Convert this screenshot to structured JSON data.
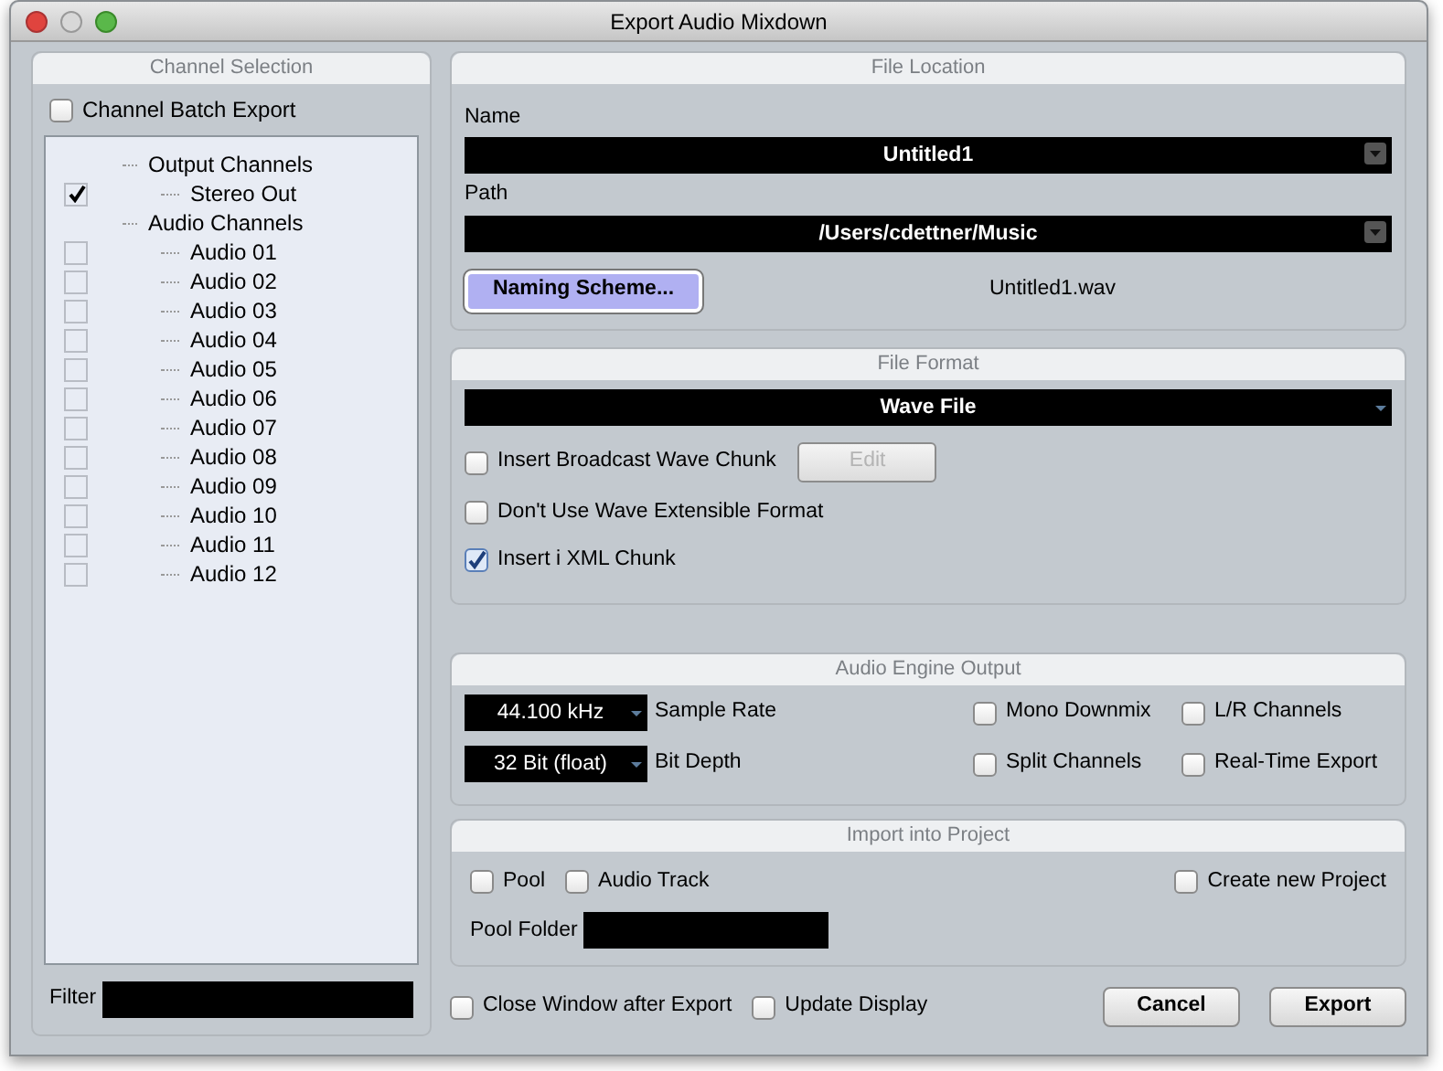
{
  "window": {
    "title": "Export Audio Mixdown"
  },
  "channel_selection": {
    "title": "Channel Selection",
    "batch_export": {
      "label": "Channel Batch Export",
      "checked": false
    },
    "tree": [
      {
        "label": "Output Channels",
        "children": [
          {
            "label": "Stereo Out",
            "checked": true
          }
        ]
      },
      {
        "label": "Audio Channels",
        "children": [
          {
            "label": "Audio 01",
            "checked": false
          },
          {
            "label": "Audio 02",
            "checked": false
          },
          {
            "label": "Audio 03",
            "checked": false
          },
          {
            "label": "Audio 04",
            "checked": false
          },
          {
            "label": "Audio 05",
            "checked": false
          },
          {
            "label": "Audio 06",
            "checked": false
          },
          {
            "label": "Audio 07",
            "checked": false
          },
          {
            "label": "Audio 08",
            "checked": false
          },
          {
            "label": "Audio 09",
            "checked": false
          },
          {
            "label": "Audio 10",
            "checked": false
          },
          {
            "label": "Audio 11",
            "checked": false
          },
          {
            "label": "Audio 12",
            "checked": false
          }
        ]
      }
    ],
    "filter": {
      "label": "Filter"
    }
  },
  "file_location": {
    "title": "File Location",
    "name_label": "Name",
    "name_value": "Untitled1",
    "path_label": "Path",
    "path_value": "/Users/cdettner/Music",
    "naming_button": "Naming Scheme...",
    "file_name": "Untitled1.wav"
  },
  "file_format": {
    "title": "File Format",
    "format": "Wave File",
    "options": [
      {
        "label": "Insert Broadcast Wave Chunk",
        "checked": false,
        "button": {
          "label": "Edit",
          "disabled": true
        }
      },
      {
        "label": "Don't Use Wave Extensible Format",
        "checked": false
      },
      {
        "label": "Insert i XML Chunk",
        "checked": true
      }
    ]
  },
  "audio_engine": {
    "title": "Audio Engine Output",
    "selects": [
      {
        "value": "44.100 kHz",
        "label": "Sample Rate"
      },
      {
        "value": "32 Bit (float)",
        "label": "Bit Depth"
      }
    ],
    "options": [
      {
        "label": "Mono Downmix",
        "checked": false
      },
      {
        "label": "L/R Channels",
        "checked": false
      },
      {
        "label": "Split Channels",
        "checked": false
      },
      {
        "label": "Real-Time Export",
        "checked": false
      }
    ]
  },
  "import_project": {
    "title": "Import into Project",
    "options": [
      {
        "label": "Pool",
        "checked": false
      },
      {
        "label": "Audio Track",
        "checked": false
      },
      {
        "label": "Create new Project",
        "checked": false
      }
    ],
    "pool_folder_label": "Pool Folder"
  },
  "footer": {
    "options": [
      {
        "label": "Close Window after Export",
        "checked": false
      },
      {
        "label": "Update Display",
        "checked": false
      }
    ],
    "buttons": [
      {
        "label": "Cancel"
      },
      {
        "label": "Export"
      }
    ]
  }
}
